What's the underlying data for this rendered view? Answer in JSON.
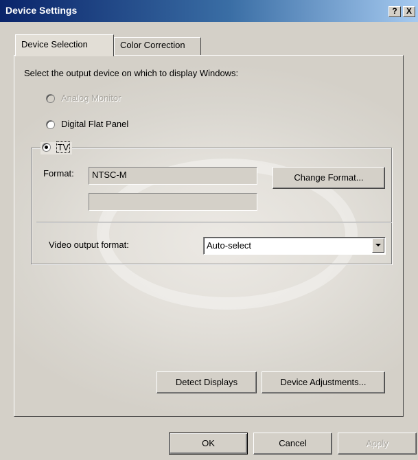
{
  "window": {
    "title": "Device Settings",
    "help_label": "?",
    "close_label": "X"
  },
  "tabs": [
    {
      "label": "Device Selection",
      "active": true
    },
    {
      "label": "Color Correction",
      "active": false
    }
  ],
  "device_selection": {
    "prompt": "Select the output device on which to display Windows:",
    "options": [
      {
        "label": "Analog Monitor",
        "enabled": false,
        "selected": false
      },
      {
        "label": "Digital Flat Panel",
        "enabled": true,
        "selected": false
      },
      {
        "label": "TV",
        "enabled": true,
        "selected": true
      }
    ],
    "tv": {
      "format_label": "Format:",
      "format_value": "NTSC-M",
      "secondary_value": "",
      "change_format_button": "Change Format...",
      "video_output_label": "Video output format:",
      "video_output_value": "Auto-select"
    },
    "detect_displays_button": "Detect Displays",
    "device_adjustments_button": "Device Adjustments..."
  },
  "footer": {
    "ok": "OK",
    "cancel": "Cancel",
    "apply": "Apply",
    "apply_enabled": false
  }
}
